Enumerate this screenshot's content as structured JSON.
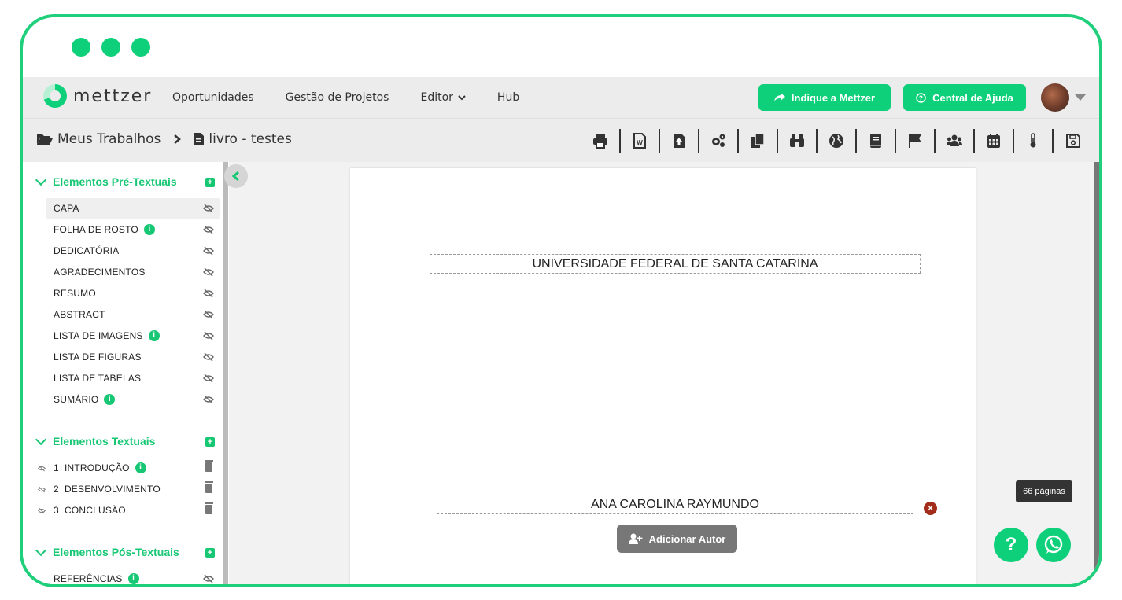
{
  "brand": {
    "name": "mettzer",
    "accent": "#0fd07a"
  },
  "nav": {
    "links": [
      "Oportunidades",
      "Gestão de Projetos",
      "Editor",
      "Hub"
    ],
    "indique": "Indique a Mettzer",
    "ajuda": "Central de Ajuda"
  },
  "breadcrumb": {
    "root": "Meus Trabalhos",
    "current": "livro - testes"
  },
  "toolbar": {
    "tools": [
      "print-icon",
      "word-icon",
      "export-icon",
      "settings-icon",
      "copy-icon",
      "binoculars-icon",
      "globe-icon",
      "book-icon",
      "flag-icon",
      "users-icon",
      "calendar-icon",
      "thermometer-icon",
      "save-icon"
    ]
  },
  "sidebar": {
    "pre": {
      "title": "Elementos Pré-Textuais",
      "items": [
        "CAPA",
        "FOLHA DE ROSTO",
        "DEDICATÓRIA",
        "AGRADECIMENTOS",
        "RESUMO",
        "ABSTRACT",
        "LISTA DE IMAGENS",
        "LISTA DE FIGURAS",
        "LISTA DE TABELAS",
        "SUMÁRIO"
      ]
    },
    "text": {
      "title": "Elementos Textuais",
      "items": [
        "1  INTRODUÇÃO",
        "2  DESENVOLVIMENTO",
        "3  CONCLUSÃO"
      ]
    },
    "post": {
      "title": "Elementos Pós-Textuais",
      "items": [
        "REFERÊNCIAS"
      ]
    }
  },
  "page": {
    "institution": "UNIVERSIDADE FEDERAL DE SANTA CATARINA",
    "author": "ANA CAROLINA RAYMUNDO",
    "add_author": "Adicionar Autor"
  },
  "page_count": "66 páginas",
  "help": {
    "question": "?"
  }
}
